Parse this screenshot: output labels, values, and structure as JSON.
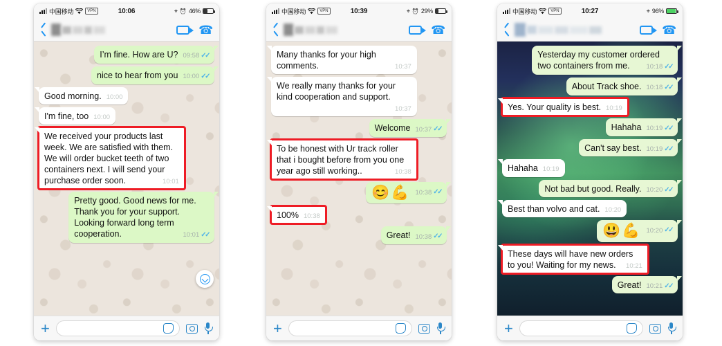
{
  "panels": [
    {
      "id": "chat-screenshot-1",
      "status": {
        "carrier": "中国移动",
        "vpn": "VPN",
        "time": "10:06",
        "battery_pct": "46%",
        "battery_level": 46,
        "battery_green": false
      },
      "nav": {
        "back": "back-icon",
        "video": "video-call-icon",
        "call": "voice-call-icon"
      },
      "background": "beige",
      "scroll_button": true,
      "messages": [
        {
          "side": "out",
          "text": "I’m fine. How are U?",
          "time": "09:58",
          "ticks": true,
          "highlight": false
        },
        {
          "side": "out",
          "text": "nice to hear from you",
          "time": "10:00",
          "ticks": true,
          "highlight": false
        },
        {
          "side": "in",
          "text": "Good morning.",
          "time": "10:00",
          "ticks": false,
          "highlight": false
        },
        {
          "side": "in",
          "text": "I'm fine, too",
          "time": "10:00",
          "ticks": false,
          "highlight": false
        },
        {
          "side": "in",
          "text": "We received your products last week. We are satisfied with them. We will order bucket teeth of two containers next. I will send your purchase order soon.",
          "time": "10:01",
          "ticks": false,
          "highlight": true
        },
        {
          "side": "out",
          "text": "Pretty good. Good news for me. Thank you for your support. Looking forward long term cooperation.",
          "time": "10:01",
          "ticks": true,
          "highlight": false
        }
      ],
      "input": {
        "placeholder": "",
        "value": ""
      }
    },
    {
      "id": "chat-screenshot-2",
      "status": {
        "carrier": "中国移动",
        "vpn": "VPN",
        "time": "10:39",
        "battery_pct": "29%",
        "battery_level": 29,
        "battery_green": false
      },
      "nav": {
        "back": "back-icon",
        "video": "video-call-icon",
        "call": "voice-call-icon"
      },
      "background": "beige",
      "scroll_button": false,
      "messages": [
        {
          "side": "in",
          "text": "Many thanks for your high comments.",
          "time": "10:37",
          "ticks": false,
          "highlight": false
        },
        {
          "side": "in",
          "text": "We really many thanks for your kind cooperation and support.",
          "time": "10:37",
          "ticks": false,
          "highlight": false
        },
        {
          "side": "out",
          "text": "Welcome",
          "time": "10:37",
          "ticks": true,
          "highlight": false
        },
        {
          "side": "in",
          "text": "To be honest with Ur track roller that i bought before from you one year ago still working..",
          "time": "10:38",
          "ticks": false,
          "highlight": true
        },
        {
          "side": "out",
          "emoji": "😊💪",
          "text": "",
          "time": "10:38",
          "ticks": true,
          "highlight": false
        },
        {
          "side": "in",
          "text": "100%",
          "time": "10:38",
          "ticks": false,
          "highlight": true
        },
        {
          "side": "out",
          "text": "Great!",
          "time": "10:38",
          "ticks": true,
          "highlight": false
        }
      ],
      "input": {
        "placeholder": "",
        "value": ""
      }
    },
    {
      "id": "chat-screenshot-3",
      "status": {
        "carrier": "中国移动",
        "vpn": "VPN",
        "time": "10:27",
        "battery_pct": "96%",
        "battery_level": 96,
        "battery_green": true
      },
      "nav": {
        "back": "back-icon",
        "video": "video-call-icon",
        "call": "voice-call-icon"
      },
      "background": "aurora",
      "scroll_button": false,
      "messages": [
        {
          "side": "out",
          "text": "Yesterday my customer ordered two containers from me.",
          "time": "10:18",
          "ticks": true,
          "highlight": false
        },
        {
          "side": "out",
          "text": "About Track shoe.",
          "time": "10:18",
          "ticks": true,
          "highlight": false
        },
        {
          "side": "in",
          "text": "Yes. Your quality is best.",
          "time": "10:19",
          "ticks": false,
          "highlight": true
        },
        {
          "side": "out",
          "text": "Hahaha",
          "time": "10:19",
          "ticks": true,
          "highlight": false
        },
        {
          "side": "out",
          "text": "Can't say best.",
          "time": "10:19",
          "ticks": true,
          "highlight": false
        },
        {
          "side": "in",
          "text": "Hahaha",
          "time": "10:19",
          "ticks": false,
          "highlight": false
        },
        {
          "side": "out",
          "text": "Not bad but good. Really.",
          "time": "10:20",
          "ticks": true,
          "highlight": false
        },
        {
          "side": "in",
          "text": "Best than volvo and cat.",
          "time": "10:20",
          "ticks": false,
          "highlight": false
        },
        {
          "side": "out",
          "emoji": "😃💪",
          "text": "",
          "time": "10:20",
          "ticks": true,
          "highlight": false
        },
        {
          "side": "in",
          "text": "These days will have new orders to you! Waiting for my news.",
          "time": "10:21",
          "ticks": false,
          "highlight": true
        },
        {
          "side": "out",
          "text": "Great!",
          "time": "10:21",
          "ticks": true,
          "highlight": false
        }
      ],
      "input": {
        "placeholder": "",
        "value": ""
      }
    }
  ],
  "colors": {
    "outgoing_bubble": "#dcf8c6",
    "incoming_bubble": "#ffffff",
    "chat_background": "#ece5dd",
    "accent_blue": "#2196f3",
    "highlight_red": "#ee1c25",
    "tick_blue": "#4fb3e8"
  },
  "icons": {
    "back": "back-chevron-icon",
    "video_call": "video-camera-icon",
    "voice_call": "phone-handset-icon",
    "plus": "plus-icon",
    "sticker": "sticker-icon",
    "camera": "camera-icon",
    "mic": "microphone-icon",
    "scroll_down": "chevron-down-circle-icon",
    "signal": "signal-bars-icon",
    "wifi": "wifi-icon",
    "location": "location-arrow-icon",
    "alarm": "alarm-clock-icon",
    "battery": "battery-icon"
  }
}
